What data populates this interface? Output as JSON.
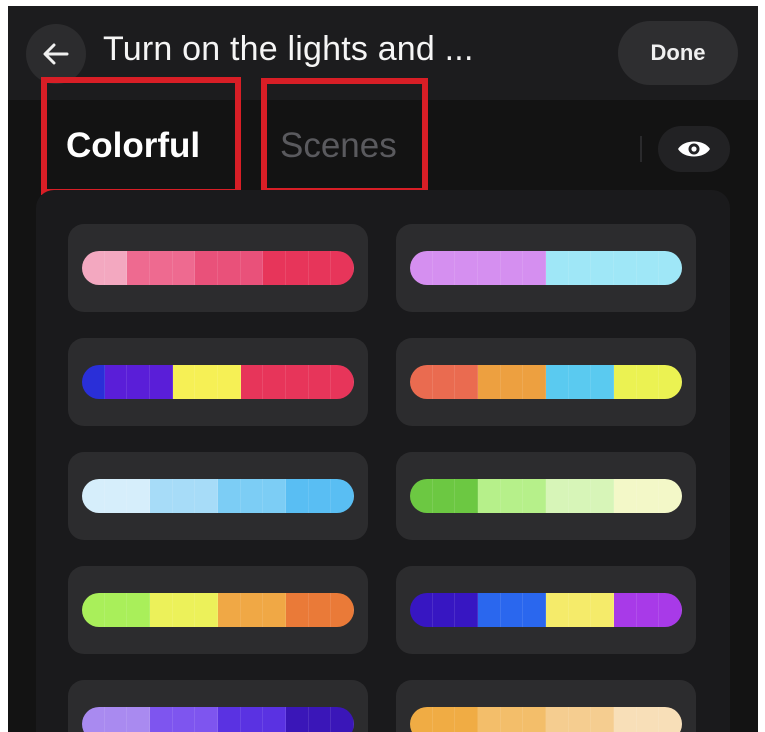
{
  "header": {
    "back_icon": "arrow-left-icon",
    "title": "Turn on the lights and ...",
    "done_label": "Done"
  },
  "tabs": [
    {
      "label": "Colorful",
      "active": true
    },
    {
      "label": "Scenes",
      "active": false
    }
  ],
  "visibility_icon": "eye-icon",
  "colors": {
    "background": "#131313",
    "header": "#1c1c1e",
    "card": "#2c2c2e",
    "highlight": "#d81e26"
  },
  "palettes": [
    {
      "column": "left",
      "row": 1,
      "colors": [
        "#f3a8c0",
        "#f3a8c0",
        "#ee6a90",
        "#ee6a90",
        "#ee6a90",
        "#e9517a",
        "#e9517a",
        "#e9517a",
        "#e7355a",
        "#e7355a",
        "#e7355a",
        "#e7355a"
      ]
    },
    {
      "column": "right",
      "row": 1,
      "colors": [
        "#d58ff0",
        "#d58ff0",
        "#d58ff0",
        "#d58ff0",
        "#d58ff0",
        "#d58ff0",
        "#9fe7f7",
        "#9fe7f7",
        "#9fe7f7",
        "#9fe7f7",
        "#9fe7f7",
        "#9fe7f7"
      ]
    },
    {
      "column": "left",
      "row": 2,
      "colors": [
        "#2a2fd8",
        "#5a1ed8",
        "#5a1ed8",
        "#5a1ed8",
        "#f6f055",
        "#f6f055",
        "#f6f055",
        "#e7355a",
        "#e7355a",
        "#e7355a",
        "#e7355a",
        "#e7355a"
      ]
    },
    {
      "column": "right",
      "row": 2,
      "colors": [
        "#ea6b50",
        "#ea6b50",
        "#ea6b50",
        "#eda040",
        "#eda040",
        "#eda040",
        "#5acaf0",
        "#5acaf0",
        "#5acaf0",
        "#ebf252",
        "#ebf252",
        "#ebf252"
      ]
    },
    {
      "column": "left",
      "row": 3,
      "colors": [
        "#d6eefb",
        "#d6eefb",
        "#d6eefb",
        "#a7dcf8",
        "#a7dcf8",
        "#a7dcf8",
        "#7ccdf5",
        "#7ccdf5",
        "#7ccdf5",
        "#59bef3",
        "#59bef3",
        "#59bef3"
      ]
    },
    {
      "column": "right",
      "row": 3,
      "colors": [
        "#6cc842",
        "#6cc842",
        "#6cc842",
        "#b6f08a",
        "#b6f08a",
        "#b6f08a",
        "#d7f5b8",
        "#d7f5b8",
        "#d7f5b8",
        "#f3f8c8",
        "#f3f8c8",
        "#f3f8c8"
      ]
    },
    {
      "column": "left",
      "row": 4,
      "colors": [
        "#a9ef5a",
        "#a9ef5a",
        "#a9ef5a",
        "#ecf15a",
        "#ecf15a",
        "#ecf15a",
        "#f0a845",
        "#f0a845",
        "#f0a845",
        "#ea7a38",
        "#ea7a38",
        "#ea7a38"
      ]
    },
    {
      "column": "right",
      "row": 4,
      "colors": [
        "#3716c2",
        "#3716c2",
        "#3716c2",
        "#2a67ee",
        "#2a67ee",
        "#2a67ee",
        "#f5eb6a",
        "#f5eb6a",
        "#f5eb6a",
        "#a83ae8",
        "#a83ae8",
        "#a83ae8"
      ]
    },
    {
      "column": "left",
      "row": 5,
      "colors": [
        "#a98af0",
        "#a98af0",
        "#a98af0",
        "#7e55ef",
        "#7e55ef",
        "#7e55ef",
        "#5a32e2",
        "#5a32e2",
        "#5a32e2",
        "#3a16b8",
        "#3a16b8",
        "#3a16b8"
      ]
    },
    {
      "column": "right",
      "row": 5,
      "colors": [
        "#f0ac44",
        "#f0ac44",
        "#f0ac44",
        "#f3be6a",
        "#f3be6a",
        "#f3be6a",
        "#f5cd90",
        "#f5cd90",
        "#f5cd90",
        "#f8dfb8",
        "#f8dfb8",
        "#f8dfb8"
      ]
    }
  ]
}
